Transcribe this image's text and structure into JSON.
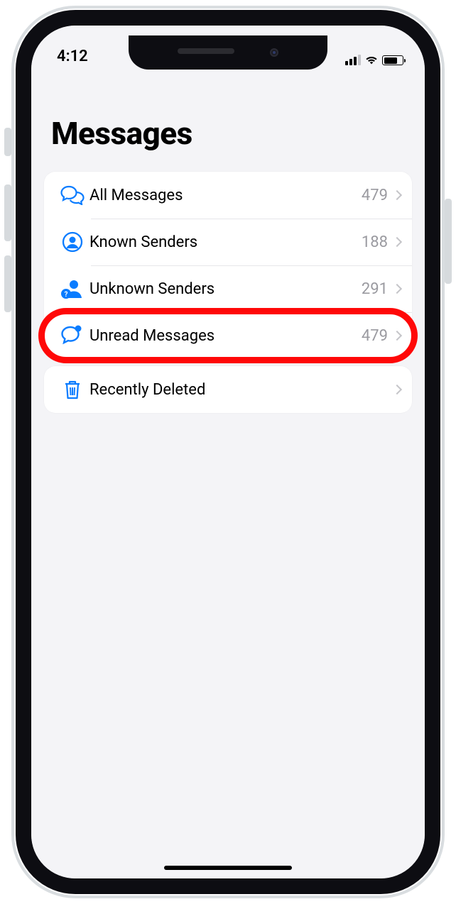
{
  "status_bar": {
    "time": "4:12"
  },
  "page": {
    "title": "Messages"
  },
  "group_main": [
    {
      "id": "all",
      "label": "All Messages",
      "count": "479",
      "icon": "chat-bubbles-icon"
    },
    {
      "id": "known",
      "label": "Known Senders",
      "count": "188",
      "icon": "person-circle-icon"
    },
    {
      "id": "unknown",
      "label": "Unknown Senders",
      "count": "291",
      "icon": "person-question-icon"
    },
    {
      "id": "unread",
      "label": "Unread Messages",
      "count": "479",
      "icon": "chat-unread-icon",
      "highlight": true
    }
  ],
  "group_secondary": [
    {
      "id": "deleted",
      "label": "Recently Deleted",
      "count": "",
      "icon": "trash-icon"
    }
  ],
  "colors": {
    "accent": "#0a7cff",
    "muted": "#9a9aa0",
    "highlight": "#ff0808"
  }
}
